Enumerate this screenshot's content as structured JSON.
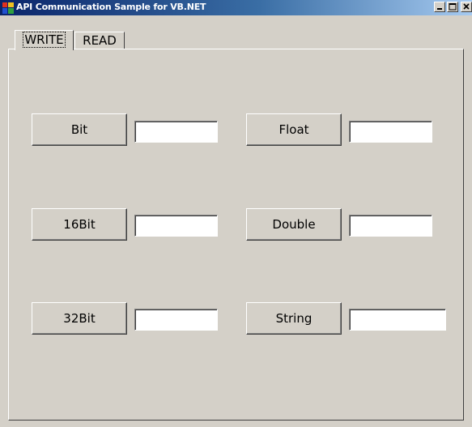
{
  "window": {
    "title": "API Communication Sample for VB.NET",
    "colors": {
      "face": "#d4d0c8",
      "title_start": "#0a246a",
      "title_end": "#a6caf0"
    },
    "controls": [
      "minimize-icon",
      "maximize-icon",
      "close-icon"
    ]
  },
  "tabs": [
    {
      "label": "WRITE",
      "selected": true
    },
    {
      "label": "READ",
      "selected": false
    }
  ],
  "buttons": {
    "bit": "Bit",
    "float": "Float",
    "bit16": "16Bit",
    "double": "Double",
    "bit32": "32Bit",
    "string": "String"
  },
  "fields": {
    "bit": "",
    "float": "",
    "bit16": "",
    "double": "",
    "bit32": "",
    "string": ""
  }
}
